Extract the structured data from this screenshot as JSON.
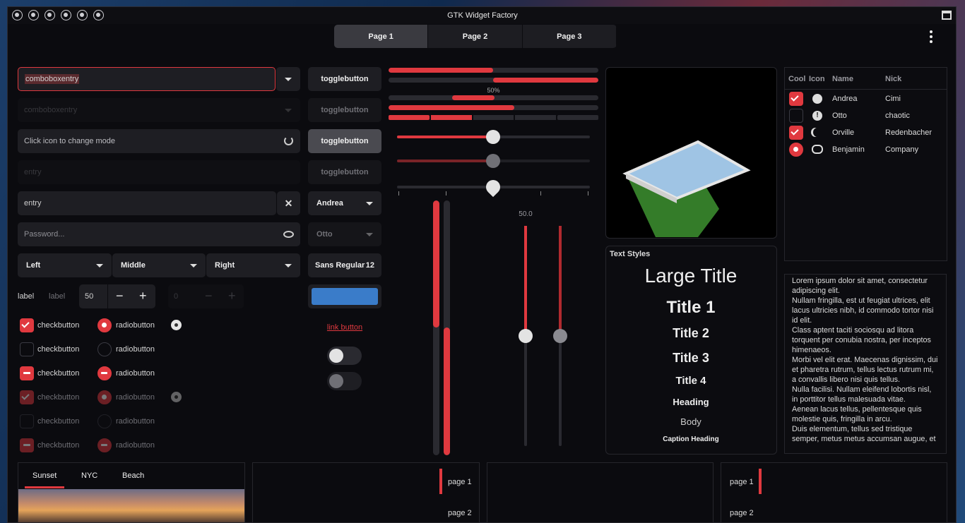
{
  "window": {
    "title": "GTK Widget Factory"
  },
  "tabs": [
    "Page 1",
    "Page 2",
    "Page 3"
  ],
  "entries": {
    "combo1": "comboboxentry",
    "combo2": "comboboxentry",
    "mode": "Click icon to change mode",
    "entry_dim": "entry",
    "entry": "entry",
    "password": "Password..."
  },
  "toggles": [
    "togglebutton",
    "togglebutton",
    "togglebutton",
    "togglebutton"
  ],
  "combos": {
    "andrea": "Andrea",
    "otto": "Otto",
    "font": "Sans Regular",
    "font_size": "12"
  },
  "linked": [
    "Left",
    "Middle",
    "Right"
  ],
  "spin": {
    "label1": "label",
    "label2": "label",
    "value": "50",
    "dim_value": "0"
  },
  "checks": [
    "checkbutton",
    "checkbutton",
    "checkbutton",
    "checkbutton",
    "checkbutton",
    "checkbutton"
  ],
  "radios": [
    "radiobutton",
    "radiobutton",
    "radiobutton",
    "radiobutton",
    "radiobutton",
    "radiobutton"
  ],
  "link": "link button",
  "progress": {
    "label": "50%",
    "values": [
      0.35,
      0.5,
      0.25,
      0.6,
      0.4
    ]
  },
  "scale": {
    "value_label": "50.0"
  },
  "text_styles": {
    "header": "Text Styles",
    "large": "Large Title",
    "t1": "Title 1",
    "t2": "Title 2",
    "t3": "Title 3",
    "t4": "Title 4",
    "heading": "Heading",
    "body": "Body",
    "caption_heading": "Caption Heading"
  },
  "tree": {
    "headers": [
      "Cool",
      "Icon",
      "Name",
      "Nick"
    ],
    "rows": [
      {
        "name": "Andrea",
        "nick": "Cimi"
      },
      {
        "name": "Otto",
        "nick": "chaotic"
      },
      {
        "name": "Orville",
        "nick": "Redenbacher"
      },
      {
        "name": "Benjamin",
        "nick": "Company"
      }
    ]
  },
  "lorem": [
    "Lorem ipsum dolor sit amet, consectetur adipiscing elit.",
    "Nullam fringilla, est ut feugiat ultrices, elit lacus ultricies nibh, id commodo tortor nisi id elit.",
    "Class aptent taciti sociosqu ad litora torquent per conubia nostra, per inceptos himenaeos.",
    "Morbi vel elit erat. Maecenas dignissim, dui et pharetra rutrum, tellus lectus rutrum mi, a convallis libero nisi quis tellus.",
    "Nulla facilisi. Nullam eleifend lobortis nisl, in porttitor tellus malesuada vitae.",
    "Aenean lacus tellus, pellentesque quis molestie quis, fringilla in arcu.",
    "Duis elementum, tellus sed tristique semper, metus metus accumsan augue, et"
  ],
  "bottom_tabs": [
    "Sunset",
    "NYC",
    "Beach"
  ],
  "pages": [
    "page 1",
    "page 2"
  ],
  "colors": {
    "accent": "#e0393f",
    "selection_blue": "#3a7cc9",
    "bg": "#0b0b0f"
  }
}
